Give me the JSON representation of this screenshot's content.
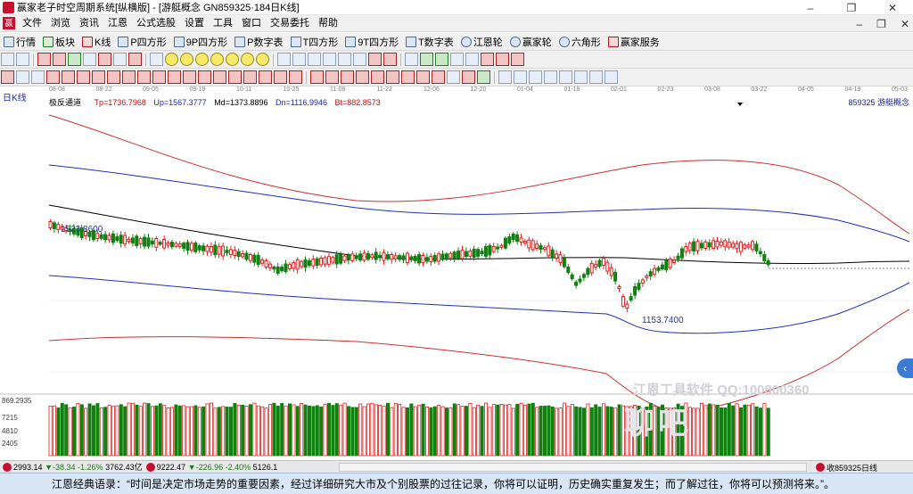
{
  "window": {
    "title": "赢家老子时空周期系统[纵横版] - [游艇概念  GN859325·184日K线]",
    "controls": [
      "–",
      "❐",
      "✕"
    ]
  },
  "menu": {
    "items": [
      "文件",
      "浏览",
      "资讯",
      "江恩",
      "公式选股",
      "设置",
      "工具",
      "窗口",
      "交易委托",
      "帮助"
    ],
    "right_controls": [
      "–",
      "❐",
      "✕"
    ]
  },
  "toolbar1": {
    "items": [
      "行情",
      "板块",
      "K线",
      "P四方形",
      "9P四方形",
      "P数字表",
      "T四方形",
      "9T四方形",
      "T数字表",
      "江恩轮",
      "赢家轮",
      "六角形",
      "赢家服务"
    ]
  },
  "chart": {
    "period_label": "日K线",
    "date_ticks": [
      "08-08",
      "08-22",
      "09-05",
      "09-19",
      "10-11",
      "10-25",
      "11-08",
      "11-22",
      "12-06",
      "12-20",
      "01-04",
      "01-18",
      "02-01",
      "02-23",
      "03-08",
      "03-22",
      "04-05",
      "04-19",
      "05-03"
    ],
    "indicator": {
      "name": "极反通道",
      "tp": "Tp=1736.7968",
      "up": "Up=1567.3777",
      "md": "Md=1373.8896",
      "dn": "Dn=1116.9946",
      "bt": "Bt=882.8573"
    },
    "code_label": "859325  游艇概念",
    "annotations": {
      "high": "1523.8600",
      "low": "1153.7400"
    },
    "volume_labels": [
      "869.2935",
      "7215",
      "4810",
      "2405"
    ],
    "side_button": "‹",
    "watermark": {
      "line1": "江恩工具软件  QQ:100800360",
      "line2": "聊吧"
    }
  },
  "statusbar": {
    "sh_price": "2993.14",
    "sh_change": "▼-38.34",
    "sh_pct": "-1.26%",
    "sh_amount": "3762.43亿",
    "sz_price": "9222.47",
    "sz_change": "▼-226.96",
    "sz_pct": "-2.40%",
    "sz_amount": "5126.1",
    "right_text": "收859325日线"
  },
  "quote": {
    "text": "江恩经典语录：“时间是决定市场走势的重要因素，经过详细研究大市及个别股票的过往记录，你将可以证明，历史确实重复发生；而了解过往，你将可以预测将来。”。"
  },
  "colors": {
    "up_candle": "#e02020",
    "down_candle": "#108010",
    "upper_band_red": "#d03030",
    "band_blue": "#2030c0",
    "mid_line": "#000000"
  }
}
